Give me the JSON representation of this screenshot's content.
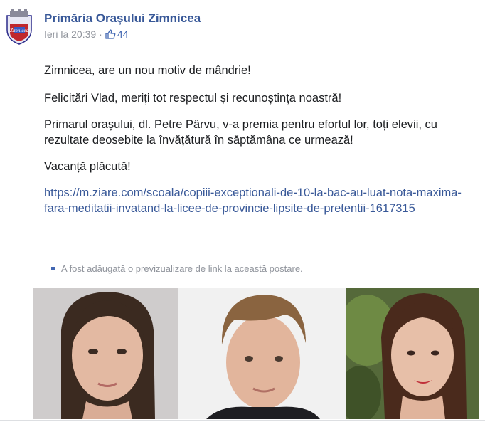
{
  "post": {
    "page_name": "Primăria Orașului Zimnicea",
    "timestamp": "Ieri la 20:39",
    "separator": "·",
    "likes": "44",
    "paragraphs": [
      "Zimnicea, are un nou motiv de mândrie!",
      "Felicitări Vlad, meriți tot respectul și recunoștința noastră!",
      "Primarul orașului, dl. Petre Pârvu, v-a premia pentru efortul lor, toți elevii, cu rezultate deosebite la învățătură în săptămâna ce urmează!",
      "Vacanță plăcută!"
    ],
    "link": "https://m.ziare.com/scoala/copiii-exceptionali-de-10-la-bac-au-luat-nota-maxima-fara-meditatii-invatand-la-licee-de-provincie-lipsite-de-pretentii-1617315",
    "link_preview_notice": "A fost adăugată o previzualizare de link la această postare.",
    "avatar_text": "Zimnicea"
  },
  "colors": {
    "page_name": "#385898",
    "link": "#385898",
    "meta": "#90949c",
    "like_accent": "#4267b2"
  },
  "icons": {
    "like": "thumbs-up-icon",
    "avatar": "coat-of-arms-icon"
  }
}
